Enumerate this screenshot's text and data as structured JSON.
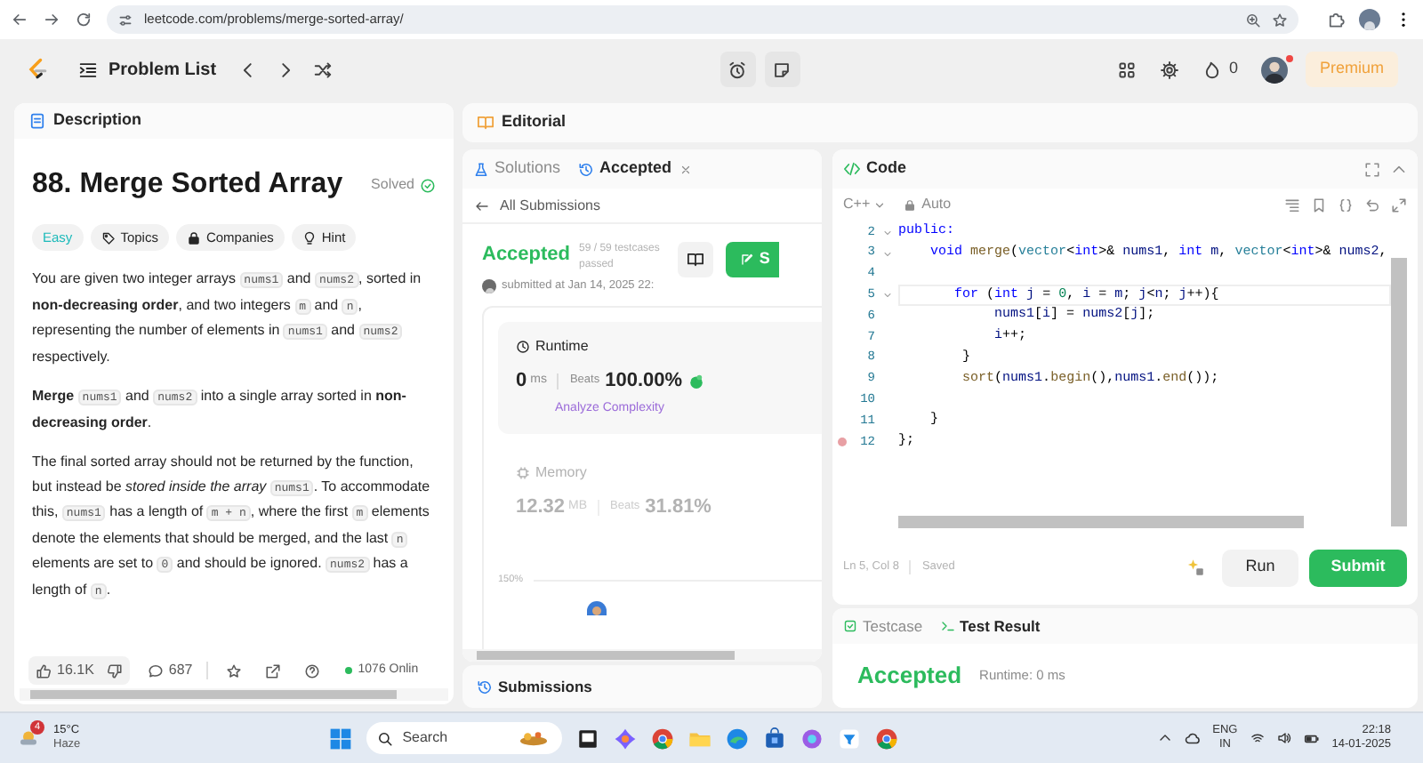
{
  "browser": {
    "url": "leetcode.com/problems/merge-sorted-array/"
  },
  "nav": {
    "title": "Problem List",
    "streak": "0",
    "premium": "Premium",
    "notification": true
  },
  "description": {
    "tab": "Description",
    "title": "88. Merge Sorted Array",
    "status": "Solved",
    "tags": [
      {
        "label": "Easy",
        "kind": "difficulty"
      },
      {
        "label": "Topics",
        "kind": "topics"
      },
      {
        "label": "Companies",
        "kind": "companies"
      },
      {
        "label": "Hint",
        "kind": "hint"
      }
    ],
    "paragraphs": [
      [
        {
          "kind": "plain",
          "text": "You are given two integer arrays "
        },
        {
          "kind": "code",
          "text": "nums1"
        },
        {
          "kind": "plain",
          "text": " and "
        },
        {
          "kind": "code",
          "text": "nums2"
        },
        {
          "kind": "plain",
          "text": ", sorted in "
        },
        {
          "kind": "bold",
          "text": "non-decreasing order"
        },
        {
          "kind": "plain",
          "text": ", and two integers "
        },
        {
          "kind": "code",
          "text": "m"
        },
        {
          "kind": "plain",
          "text": " and "
        },
        {
          "kind": "code",
          "text": "n"
        },
        {
          "kind": "plain",
          "text": ", representing the number of elements in "
        },
        {
          "kind": "code",
          "text": "nums1"
        },
        {
          "kind": "plain",
          "text": " and "
        },
        {
          "kind": "code",
          "text": "nums2"
        },
        {
          "kind": "plain",
          "text": " respectively."
        }
      ],
      [
        {
          "kind": "bold",
          "text": "Merge "
        },
        {
          "kind": "code",
          "text": "nums1"
        },
        {
          "kind": "plain",
          "text": " and "
        },
        {
          "kind": "code",
          "text": "nums2"
        },
        {
          "kind": "plain",
          "text": " into a single array sorted in "
        },
        {
          "kind": "bold",
          "text": "non-decreasing order"
        },
        {
          "kind": "plain",
          "text": "."
        }
      ],
      [
        {
          "kind": "plain",
          "text": "The final sorted array should not be returned by the function, but instead be "
        },
        {
          "kind": "italic",
          "text": "stored inside the array "
        },
        {
          "kind": "code",
          "text": "nums1"
        },
        {
          "kind": "plain",
          "text": ". To accommodate this, "
        },
        {
          "kind": "code",
          "text": "nums1"
        },
        {
          "kind": "plain",
          "text": " has a length of "
        },
        {
          "kind": "code",
          "text": "m + n"
        },
        {
          "kind": "plain",
          "text": ", where the first "
        },
        {
          "kind": "code",
          "text": "m"
        },
        {
          "kind": "plain",
          "text": " elements denote the elements that should be merged, and the last "
        },
        {
          "kind": "code",
          "text": "n"
        },
        {
          "kind": "plain",
          "text": " elements are set to "
        },
        {
          "kind": "code",
          "text": "0"
        },
        {
          "kind": "plain",
          "text": " and should be ignored. "
        },
        {
          "kind": "code",
          "text": "nums2"
        },
        {
          "kind": "plain",
          "text": " has a length of "
        },
        {
          "kind": "code",
          "text": "n"
        },
        {
          "kind": "plain",
          "text": "."
        }
      ]
    ],
    "likes": "16.1K",
    "comments": "687",
    "online": "1076 Onlin"
  },
  "editorial": {
    "tab": "Editorial"
  },
  "submission": {
    "tabs": [
      {
        "label": "Solutions",
        "selected": false,
        "kind": "solutions"
      },
      {
        "label": "Accepted",
        "selected": true,
        "kind": "history"
      }
    ],
    "back": "All Submissions",
    "result": "Accepted",
    "testcases": "59 / 59 testcases",
    "passed": "passed",
    "submitted": "submitted at Jan 14, 2025 22:",
    "solution_button": "S",
    "runtime": {
      "label": "Runtime",
      "value": "0",
      "unit": "ms",
      "beats_label": "Beats",
      "beats": "100.00%",
      "link": "Analyze Complexity"
    },
    "memory": {
      "label": "Memory",
      "value": "12.32",
      "unit": "MB",
      "beats_label": "Beats",
      "beats": "31.81%"
    },
    "axis_label": "150%",
    "footer": "Submissions"
  },
  "code": {
    "tab": "Code",
    "language": "C++",
    "mode": "Auto",
    "lines": [
      {
        "number": "2",
        "foldable": true,
        "current": false,
        "breakpoint": false,
        "tokens": [
          {
            "kind": "keyword",
            "text": "public:"
          }
        ]
      },
      {
        "number": "3",
        "foldable": true,
        "current": false,
        "breakpoint": false,
        "tokens": [
          {
            "kind": "keyword",
            "text": "    void "
          },
          {
            "kind": "function",
            "text": "merge"
          },
          {
            "kind": "plain",
            "text": "("
          },
          {
            "kind": "type",
            "text": "vector"
          },
          {
            "kind": "plain",
            "text": "<"
          },
          {
            "kind": "keyword",
            "text": "int"
          },
          {
            "kind": "plain",
            "text": ">& "
          },
          {
            "kind": "variable",
            "text": "nums1"
          },
          {
            "kind": "plain",
            "text": ", "
          },
          {
            "kind": "keyword",
            "text": "int "
          },
          {
            "kind": "variable",
            "text": "m"
          },
          {
            "kind": "plain",
            "text": ", "
          },
          {
            "kind": "type",
            "text": "vector"
          },
          {
            "kind": "plain",
            "text": "<"
          },
          {
            "kind": "keyword",
            "text": "int"
          },
          {
            "kind": "plain",
            "text": ">& "
          },
          {
            "kind": "variable",
            "text": "nums2"
          },
          {
            "kind": "plain",
            "text": ","
          }
        ]
      },
      {
        "number": "4",
        "foldable": false,
        "current": false,
        "breakpoint": false
      },
      {
        "number": "5",
        "foldable": true,
        "current": true,
        "breakpoint": false,
        "tokens": [
          {
            "kind": "keyword",
            "text": "       for"
          },
          {
            "kind": "plain",
            "text": " ("
          },
          {
            "kind": "keyword",
            "text": "int "
          },
          {
            "kind": "variable",
            "text": "j"
          },
          {
            "kind": "plain",
            "text": " = "
          },
          {
            "kind": "number",
            "text": "0"
          },
          {
            "kind": "plain",
            "text": ", "
          },
          {
            "kind": "variable",
            "text": "i"
          },
          {
            "kind": "plain",
            "text": " = "
          },
          {
            "kind": "variable",
            "text": "m"
          },
          {
            "kind": "plain",
            "text": "; "
          },
          {
            "kind": "variable",
            "text": "j"
          },
          {
            "kind": "plain",
            "text": "<"
          },
          {
            "kind": "variable",
            "text": "n"
          },
          {
            "kind": "plain",
            "text": "; "
          },
          {
            "kind": "variable",
            "text": "j"
          },
          {
            "kind": "plain",
            "text": "++){"
          }
        ]
      },
      {
        "number": "6",
        "foldable": false,
        "current": false,
        "breakpoint": false,
        "tokens": [
          {
            "kind": "variable",
            "text": "            nums1"
          },
          {
            "kind": "plain",
            "text": "["
          },
          {
            "kind": "variable",
            "text": "i"
          },
          {
            "kind": "plain",
            "text": "] = "
          },
          {
            "kind": "variable",
            "text": "nums2"
          },
          {
            "kind": "plain",
            "text": "["
          },
          {
            "kind": "variable",
            "text": "j"
          },
          {
            "kind": "plain",
            "text": "];"
          }
        ]
      },
      {
        "number": "7",
        "foldable": false,
        "current": false,
        "breakpoint": false,
        "tokens": [
          {
            "kind": "variable",
            "text": "            i"
          },
          {
            "kind": "plain",
            "text": "++;"
          }
        ]
      },
      {
        "number": "8",
        "foldable": false,
        "current": false,
        "breakpoint": false,
        "tokens": [
          {
            "kind": "plain",
            "text": "        }"
          }
        ]
      },
      {
        "number": "9",
        "foldable": false,
        "current": false,
        "breakpoint": false,
        "tokens": [
          {
            "kind": "function",
            "text": "        sort"
          },
          {
            "kind": "plain",
            "text": "("
          },
          {
            "kind": "variable",
            "text": "nums1"
          },
          {
            "kind": "plain",
            "text": "."
          },
          {
            "kind": "function",
            "text": "begin"
          },
          {
            "kind": "plain",
            "text": "(),"
          },
          {
            "kind": "variable",
            "text": "nums1"
          },
          {
            "kind": "plain",
            "text": "."
          },
          {
            "kind": "function",
            "text": "end"
          },
          {
            "kind": "plain",
            "text": "());"
          }
        ]
      },
      {
        "number": "10",
        "foldable": false,
        "current": false,
        "breakpoint": false
      },
      {
        "number": "11",
        "foldable": false,
        "current": false,
        "breakpoint": false,
        "tokens": [
          {
            "kind": "plain",
            "text": "    }"
          }
        ]
      },
      {
        "number": "12",
        "foldable": false,
        "current": false,
        "breakpoint": true,
        "tokens": [
          {
            "kind": "plain",
            "text": "};"
          }
        ]
      }
    ],
    "cursor": "Ln 5, Col 8",
    "saved": "Saved",
    "run": "Run",
    "submit": "Submit"
  },
  "test": {
    "tabs": [
      {
        "label": "Testcase",
        "selected": false,
        "kind": "testcase"
      },
      {
        "label": "Test Result",
        "selected": true,
        "kind": "result"
      }
    ],
    "result": "Accepted",
    "runtime": "Runtime: 0 ms"
  },
  "taskbar": {
    "weather_badge": "4",
    "temperature": "15°C",
    "condition": "Haze",
    "search": "Search",
    "language": "ENG",
    "region": "IN",
    "time": "22:18",
    "date": "14-01-2025"
  }
}
